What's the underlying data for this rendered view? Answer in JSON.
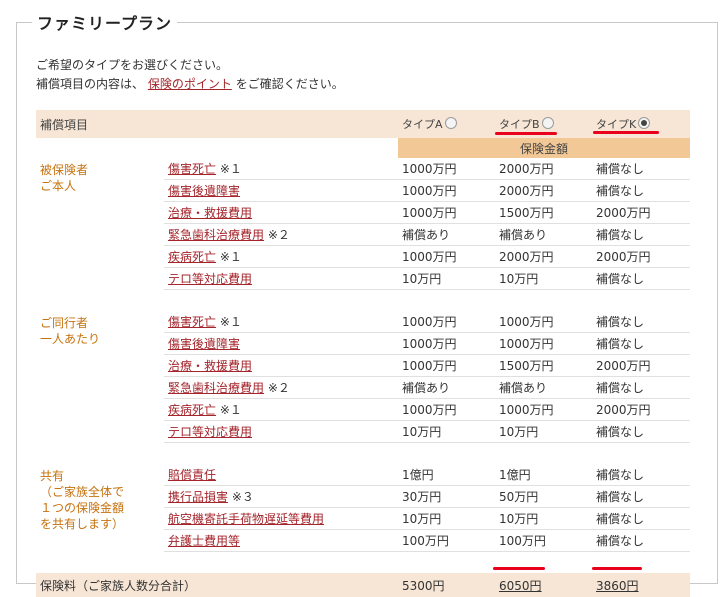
{
  "title": "ファミリープラン",
  "intro": {
    "line1": "ご希望のタイプをお選びください。",
    "line2_pre": "補償項目の内容は、",
    "line2_link": "保険のポイント",
    "line2_post": "をご確認ください。"
  },
  "header": {
    "item_col": "補償項目",
    "types": [
      {
        "label": "タイプA",
        "selected": false
      },
      {
        "label": "タイプB",
        "selected": false
      },
      {
        "label": "タイプK",
        "selected": true
      }
    ],
    "amount_label": "保険金額"
  },
  "groups": [
    {
      "name_line1": "被保険者",
      "name_line2": "ご本人",
      "name_line3": "",
      "name_line4": "",
      "rows": [
        {
          "item": "傷害死亡",
          "note": "※１",
          "a": "1000万円",
          "b": "2000万円",
          "k": "補償なし"
        },
        {
          "item": "傷害後遺障害",
          "note": "",
          "a": "1000万円",
          "b": "2000万円",
          "k": "補償なし"
        },
        {
          "item": "治療・救援費用",
          "note": "",
          "a": "1000万円",
          "b": "1500万円",
          "k": "2000万円"
        },
        {
          "item": "緊急歯科治療費用",
          "note": "※２",
          "a": "補償あり",
          "b": "補償あり",
          "k": "補償なし"
        },
        {
          "item": "疾病死亡",
          "note": "※１",
          "a": "1000万円",
          "b": "2000万円",
          "k": "2000万円"
        },
        {
          "item": "テロ等対応費用",
          "note": "",
          "a": "10万円",
          "b": "10万円",
          "k": "補償なし"
        }
      ]
    },
    {
      "name_line1": "ご同行者",
      "name_line2": "一人あたり",
      "name_line3": "",
      "name_line4": "",
      "rows": [
        {
          "item": "傷害死亡",
          "note": "※１",
          "a": "1000万円",
          "b": "1000万円",
          "k": "補償なし"
        },
        {
          "item": "傷害後遺障害",
          "note": "",
          "a": "1000万円",
          "b": "1000万円",
          "k": "補償なし"
        },
        {
          "item": "治療・救援費用",
          "note": "",
          "a": "1000万円",
          "b": "1500万円",
          "k": "2000万円"
        },
        {
          "item": "緊急歯科治療費用",
          "note": "※２",
          "a": "補償あり",
          "b": "補償あり",
          "k": "補償なし"
        },
        {
          "item": "疾病死亡",
          "note": "※１",
          "a": "1000万円",
          "b": "1000万円",
          "k": "2000万円"
        },
        {
          "item": "テロ等対応費用",
          "note": "",
          "a": "10万円",
          "b": "10万円",
          "k": "補償なし"
        }
      ]
    },
    {
      "name_line1": "共有",
      "name_line2": "（ご家族全体で",
      "name_line3": "１つの保険金額",
      "name_line4": "を共有します）",
      "rows": [
        {
          "item": "賠償責任",
          "note": "",
          "a": "1億円",
          "b": "1億円",
          "k": "補償なし"
        },
        {
          "item": "携行品損害",
          "note": "※３",
          "a": "30万円",
          "b": "50万円",
          "k": "補償なし"
        },
        {
          "item": "航空機寄託手荷物遅延等費用",
          "note": "",
          "a": "10万円",
          "b": "10万円",
          "k": "補償なし"
        },
        {
          "item": "弁護士費用等",
          "note": "",
          "a": "100万円",
          "b": "100万円",
          "k": "補償なし"
        }
      ]
    }
  ],
  "fee": {
    "label": "保険料（ご家族人数分合計）",
    "a": "5300円",
    "b": "6050円",
    "k": "3860円"
  },
  "colors": {
    "header_bg": "#f7e6d6",
    "amount_bg": "#f2c896",
    "group_text": "#c6720f",
    "link": "#a4262c",
    "annotation": "#e8001c"
  }
}
